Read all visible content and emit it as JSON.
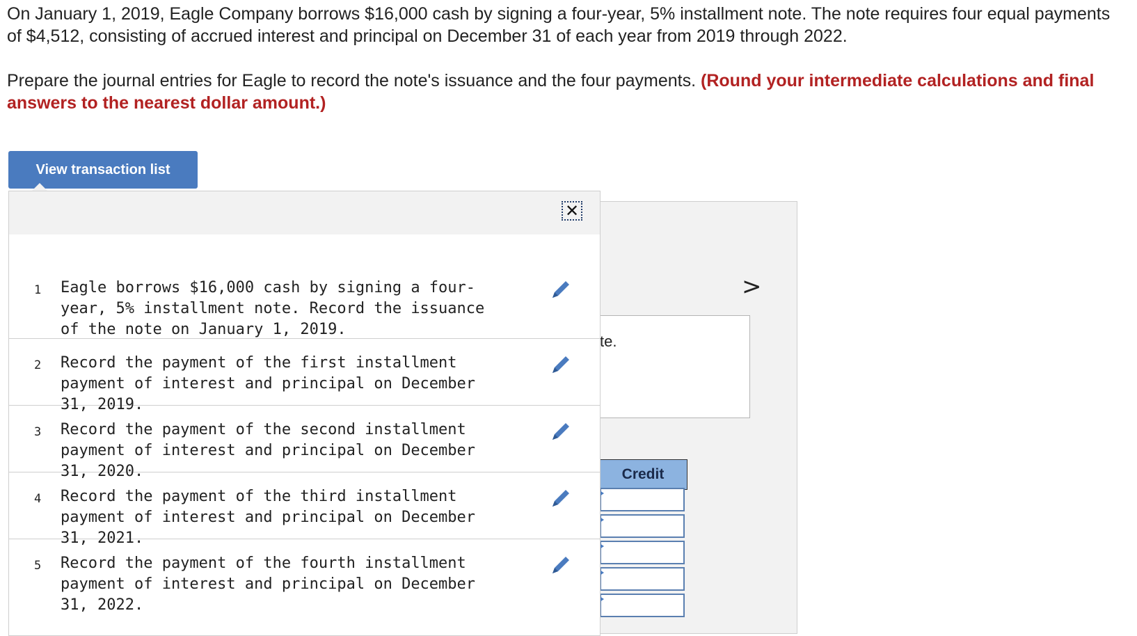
{
  "problem": {
    "paragraph1": "On January 1, 2019, Eagle Company borrows $16,000 cash by signing a four-year, 5% installment note. The note requires four equal payments of $4,512, consisting of accrued interest and principal on December 31 of each year from 2019 through 2022.",
    "paragraph2_plain": "Prepare the journal entries for Eagle to record the note's issuance and the four payments. ",
    "paragraph2_emphasis": "(Round your intermediate calculations and final answers to the nearest dollar amount.)"
  },
  "view_button_label": "View transaction list",
  "popup": {
    "close_icon": "close-icon",
    "transactions": [
      {
        "number": "1",
        "text": "Eagle borrows $16,000 cash by signing a four-year, 5% installment note. Record the issuance of the note on January 1, 2019."
      },
      {
        "number": "2",
        "text": "Record the payment of the first installment payment of interest and principal on December 31, 2019."
      },
      {
        "number": "3",
        "text": "Record the payment of the second installment payment of interest and principal on December 31, 2020."
      },
      {
        "number": "4",
        "text": "Record the payment of the third installment payment of interest and principal on December 31, 2021."
      },
      {
        "number": "5",
        "text": "Record the payment of the fourth installment payment of interest and principal on December 31, 2022."
      }
    ]
  },
  "journal": {
    "next_arrow": ">",
    "note_fragment": "te.",
    "credit_header": "Credit"
  },
  "colors": {
    "button": "#4a7bbf",
    "emphasis": "#b22222",
    "credit_header": "#8cb3e0",
    "edit_icon": "#4a7bbf"
  }
}
